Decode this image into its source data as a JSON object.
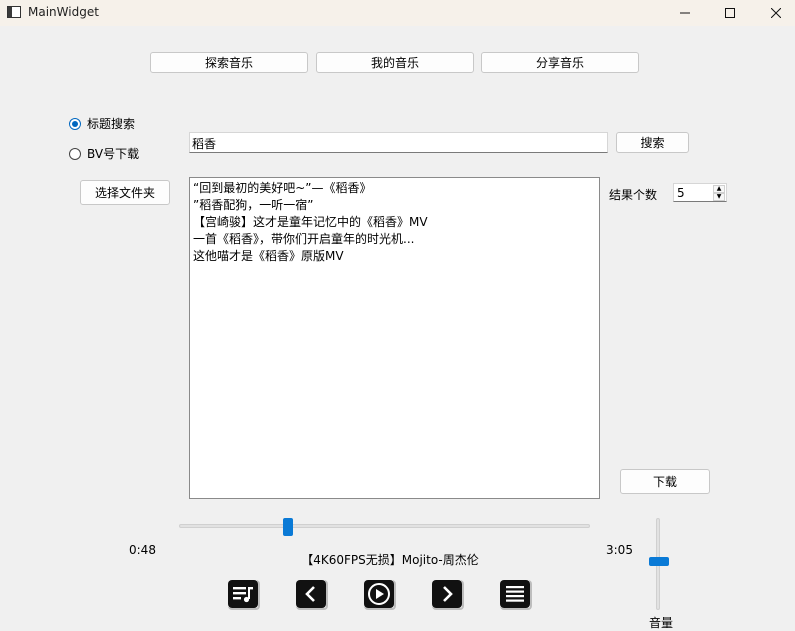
{
  "window": {
    "title": "MainWidget"
  },
  "tabs": [
    {
      "label": "探索音乐"
    },
    {
      "label": "我的音乐"
    },
    {
      "label": "分享音乐"
    }
  ],
  "search_mode": {
    "options": [
      {
        "label": "标题搜索",
        "checked": true
      },
      {
        "label": "BV号下载",
        "checked": false
      }
    ]
  },
  "search": {
    "value": "稻香",
    "button_label": "搜索"
  },
  "folder_button_label": "选择文件夹",
  "results": {
    "items": [
      "“回到最初的美好吧~”—《稻香》",
      "”稻香配狗，一听一宿”",
      "【宫崎骏】这才是童年记忆中的《稻香》MV",
      "一首《稻香》，带你们开启童年的时光机...",
      "这他喵才是《稻香》原版MV"
    ]
  },
  "result_count": {
    "label": "结果个数",
    "value": "5"
  },
  "download_button_label": "下载",
  "player": {
    "current_time": "0:48",
    "total_time": "3:05",
    "progress_fraction": 0.26,
    "track_title": "【4K60FPS无损】Mojito-周杰伦",
    "volume_label": "音量",
    "volume_fraction": 0.53
  },
  "colors": {
    "accent": "#0a7ad6",
    "radio_accent": "#0067c0",
    "titlebar": "#f6f1ea",
    "background": "#f0f0f0"
  }
}
